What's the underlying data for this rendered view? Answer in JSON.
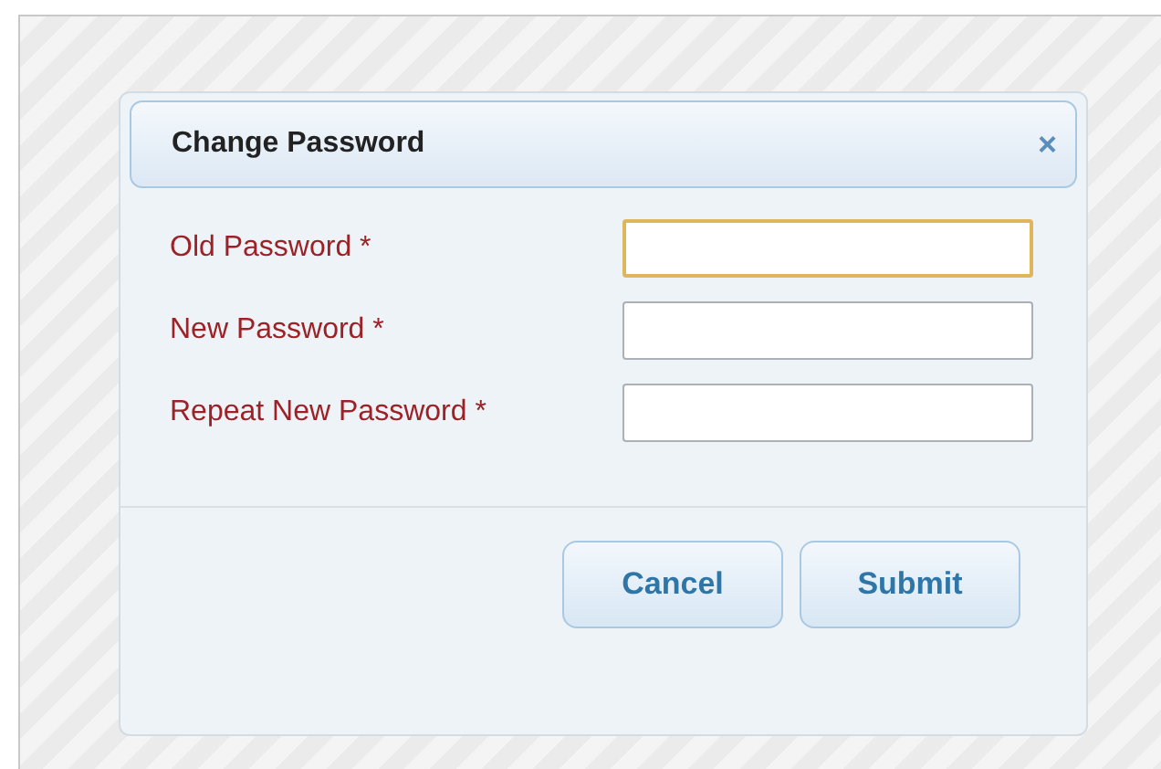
{
  "dialog": {
    "title": "Change Password",
    "close": "×"
  },
  "fields": [
    {
      "label": "Old Password *",
      "focused": true
    },
    {
      "label": "New Password *",
      "focused": false
    },
    {
      "label": "Repeat New Password *",
      "focused": false
    }
  ],
  "buttons": [
    "Cancel",
    "Submit"
  ]
}
